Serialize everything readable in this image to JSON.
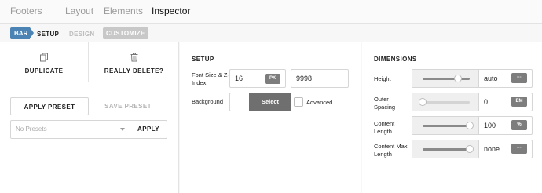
{
  "topnav": {
    "items": [
      "Footers",
      "Layout",
      "Elements",
      "Inspector"
    ]
  },
  "subnav": {
    "badge": "BAR",
    "setup": "SETUP",
    "design": "DESIGN",
    "customize": "CUSTOMIZE"
  },
  "actions": {
    "duplicate": "DUPLICATE",
    "delete": "REALLY DELETE?",
    "duplicate_icon": "copy-icon",
    "delete_icon": "trash-icon"
  },
  "presets": {
    "apply_preset": "APPLY PRESET",
    "save_preset": "SAVE PRESET",
    "placeholder": "No Presets",
    "apply": "APPLY"
  },
  "setup": {
    "heading": "SETUP",
    "font_label": "Font Size & Z-Index",
    "font_size": "16",
    "font_unit": "PX",
    "z_index": "9998",
    "background_label": "Background",
    "select_label": "Select",
    "advanced_label": "Advanced"
  },
  "dimensions": {
    "heading": "DIMENSIONS",
    "rows": [
      {
        "label": "Height",
        "value": "auto",
        "unit": "···",
        "slider_level": 0.75
      },
      {
        "label": "Outer Spacing",
        "value": "0",
        "unit": "EM",
        "slider_level": 0.0
      },
      {
        "label": "Content Length",
        "value": "100",
        "unit": "%",
        "slider_level": 1.0
      },
      {
        "label": "Content Max Length",
        "value": "none",
        "unit": "···",
        "slider_level": 1.0
      }
    ]
  },
  "colors": {
    "accent": "#4a83b4",
    "chip": "#7d7d7d",
    "select_button": "#6f6f6f"
  }
}
